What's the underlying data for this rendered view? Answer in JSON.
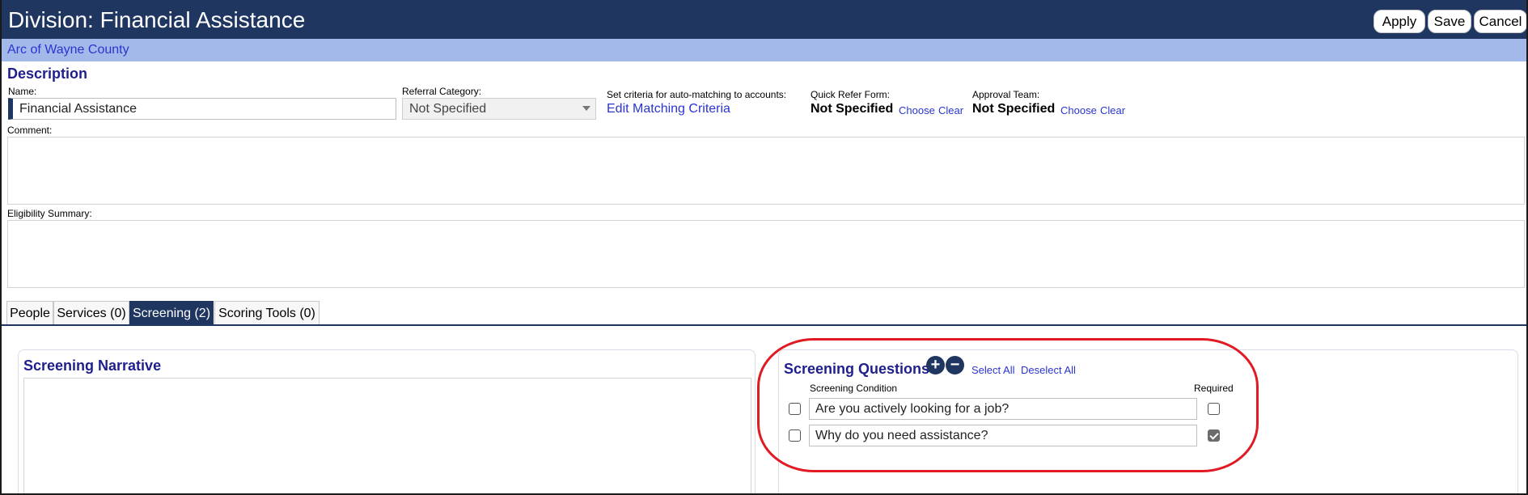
{
  "header": {
    "title": "Division: Financial Assistance",
    "apply_label": "Apply",
    "save_label": "Save",
    "cancel_label": "Cancel"
  },
  "org": {
    "name": "Arc of Wayne County"
  },
  "description": {
    "title": "Description",
    "name_label": "Name:",
    "name_value": "Financial Assistance",
    "referral_label": "Referral Category:",
    "referral_value": "Not Specified",
    "criteria_label": "Set criteria for auto-matching to accounts:",
    "criteria_link": "Edit Matching Criteria",
    "quick_refer_label": "Quick Refer Form:",
    "quick_refer_value": "Not Specified",
    "approval_label": "Approval Team:",
    "approval_value": "Not Specified",
    "choose_label": "Choose",
    "clear_label": "Clear",
    "comment_label": "Comment:",
    "eligibility_label": "Eligibility Summary:"
  },
  "tabs": [
    {
      "label": "People",
      "active": false
    },
    {
      "label": "Services (0)",
      "active": false
    },
    {
      "label": "Screening (2)",
      "active": true
    },
    {
      "label": "Scoring Tools (0)",
      "active": false
    }
  ],
  "screening": {
    "narrative_title": "Screening Narrative",
    "questions_title": "Screening Questions",
    "select_all": "Select All",
    "deselect_all": "Deselect All",
    "condition_header": "Screening Condition",
    "required_header": "Required",
    "questions": [
      {
        "text": "Are you actively looking for a job?",
        "selected": false,
        "required": false
      },
      {
        "text": "Why do you need assistance?",
        "selected": false,
        "required": true
      }
    ]
  },
  "colors": {
    "header_bg": "#1f3660",
    "org_bar_bg": "#a3b9ea",
    "link": "#2a35d0",
    "section_title": "#1e1f8c",
    "highlight": "#e01b24"
  },
  "icons": [
    "plus-circle-icon",
    "minus-circle-icon",
    "chevron-down-icon",
    "checkbox-icon"
  ]
}
